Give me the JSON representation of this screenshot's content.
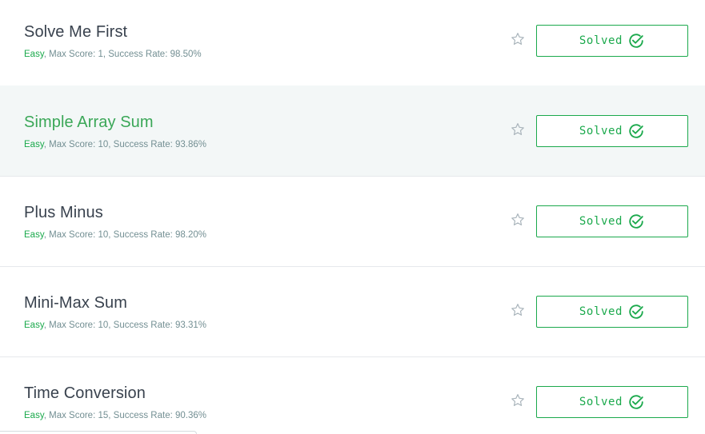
{
  "colors": {
    "accent": "#1ba94c",
    "title": "#39424e",
    "meta": "#738f93",
    "hover_bg": "#f3f7f7"
  },
  "icons": {
    "favorite": "star-outline-icon",
    "solved": "check-circle-icon"
  },
  "challenges": [
    {
      "title": "Solve Me First",
      "difficulty": "Easy",
      "details": ", Max Score: 1, Success Rate: 98.50%",
      "status": "Solved",
      "hovered": false
    },
    {
      "title": "Simple Array Sum",
      "difficulty": "Easy",
      "details": ", Max Score: 10, Success Rate: 93.86%",
      "status": "Solved",
      "hovered": true
    },
    {
      "title": "Plus Minus",
      "difficulty": "Easy",
      "details": ", Max Score: 10, Success Rate: 98.20%",
      "status": "Solved",
      "hovered": false
    },
    {
      "title": "Mini-Max Sum",
      "difficulty": "Easy",
      "details": ", Max Score: 10, Success Rate: 93.31%",
      "status": "Solved",
      "hovered": false
    },
    {
      "title": "Time Conversion",
      "difficulty": "Easy",
      "details": ", Max Score: 15, Success Rate: 90.36%",
      "status": "Solved",
      "hovered": false
    }
  ]
}
